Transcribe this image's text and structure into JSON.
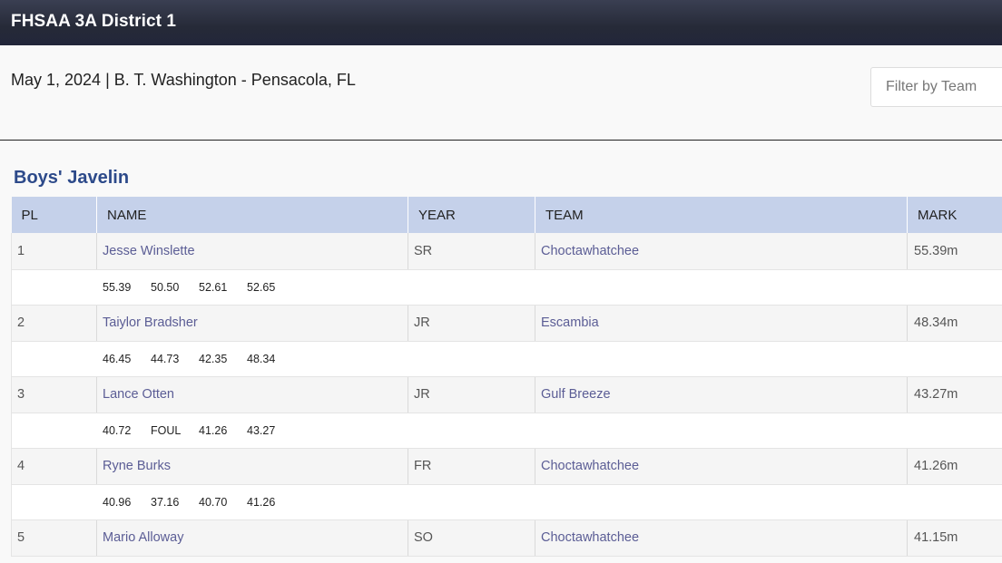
{
  "header": {
    "title": "FHSAA 3A District 1"
  },
  "meet": {
    "info": "May 1, 2024 | B. T. Washington - Pensacola, FL"
  },
  "filter": {
    "placeholder": "Filter by Team"
  },
  "event": {
    "title": "Boys' Javelin"
  },
  "table": {
    "columns": [
      "PL",
      "NAME",
      "YEAR",
      "TEAM",
      "MARK"
    ],
    "rows": [
      {
        "pl": "1",
        "name": "Jesse Winslette",
        "year": "SR",
        "team": "Choctawhatchee",
        "mark": "55.39m",
        "attempts": [
          "55.39",
          "50.50",
          "52.61",
          "52.65"
        ]
      },
      {
        "pl": "2",
        "name": "Taiylor Bradsher",
        "year": "JR",
        "team": "Escambia",
        "mark": "48.34m",
        "attempts": [
          "46.45",
          "44.73",
          "42.35",
          "48.34"
        ]
      },
      {
        "pl": "3",
        "name": "Lance Otten",
        "year": "JR",
        "team": "Gulf Breeze",
        "mark": "43.27m",
        "attempts": [
          "40.72",
          "FOUL",
          "41.26",
          "43.27"
        ]
      },
      {
        "pl": "4",
        "name": "Ryne Burks",
        "year": "FR",
        "team": "Choctawhatchee",
        "mark": "41.26m",
        "attempts": [
          "40.96",
          "37.16",
          "40.70",
          "41.26"
        ]
      },
      {
        "pl": "5",
        "name": "Mario Alloway",
        "year": "SO",
        "team": "Choctawhatchee",
        "mark": "41.15m",
        "attempts": []
      }
    ]
  }
}
